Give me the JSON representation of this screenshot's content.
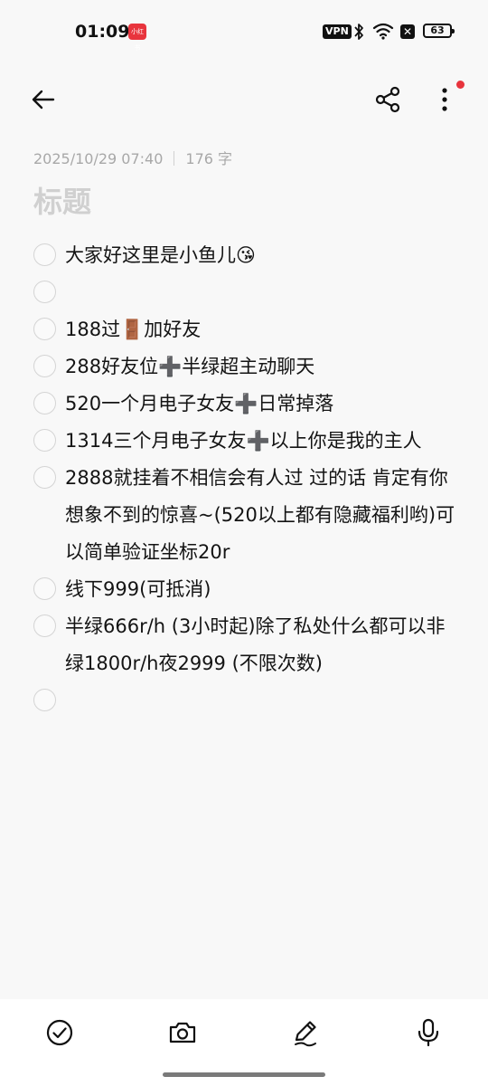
{
  "status_bar": {
    "time": "01:09",
    "app_badge": "小红书",
    "vpn": "VPN",
    "battery": "63"
  },
  "top_bar": {
    "back_icon": "arrow-left",
    "share_icon": "share",
    "more_icon": "more-vertical",
    "notification_dot_color": "#e8343d"
  },
  "note": {
    "date": "2025/10/29 07:40",
    "char_count": "176 字",
    "title_placeholder": "标题",
    "items": [
      {
        "text": "大家好这里是小鱼儿😘",
        "checked": false
      },
      {
        "text": "",
        "checked": false
      },
      {
        "text": "188过🚪加好友",
        "checked": false
      },
      {
        "text": "288好友位➕半绿超主动聊天",
        "checked": false
      },
      {
        "text": "520一个月电子女友➕日常掉落",
        "checked": false
      },
      {
        "text": "1314三个月电子女友➕以上你是我的主人",
        "checked": false
      },
      {
        "text": "2888就挂着不相信会有人过 过的话 肯定有你想象不到的惊喜~(520以上都有隐藏福利哟)可以简单验证坐标20r",
        "checked": false
      },
      {
        "text": "线下999(可抵消)",
        "checked": false
      },
      {
        "text": "半绿666r/h (3小时起)除了私处什么都可以非绿1800r/h夜2999 (不限次数)",
        "checked": false
      },
      {
        "text": "",
        "checked": false
      }
    ]
  },
  "toolbar": {
    "icons": [
      "check-circle",
      "camera",
      "pen",
      "microphone"
    ]
  }
}
